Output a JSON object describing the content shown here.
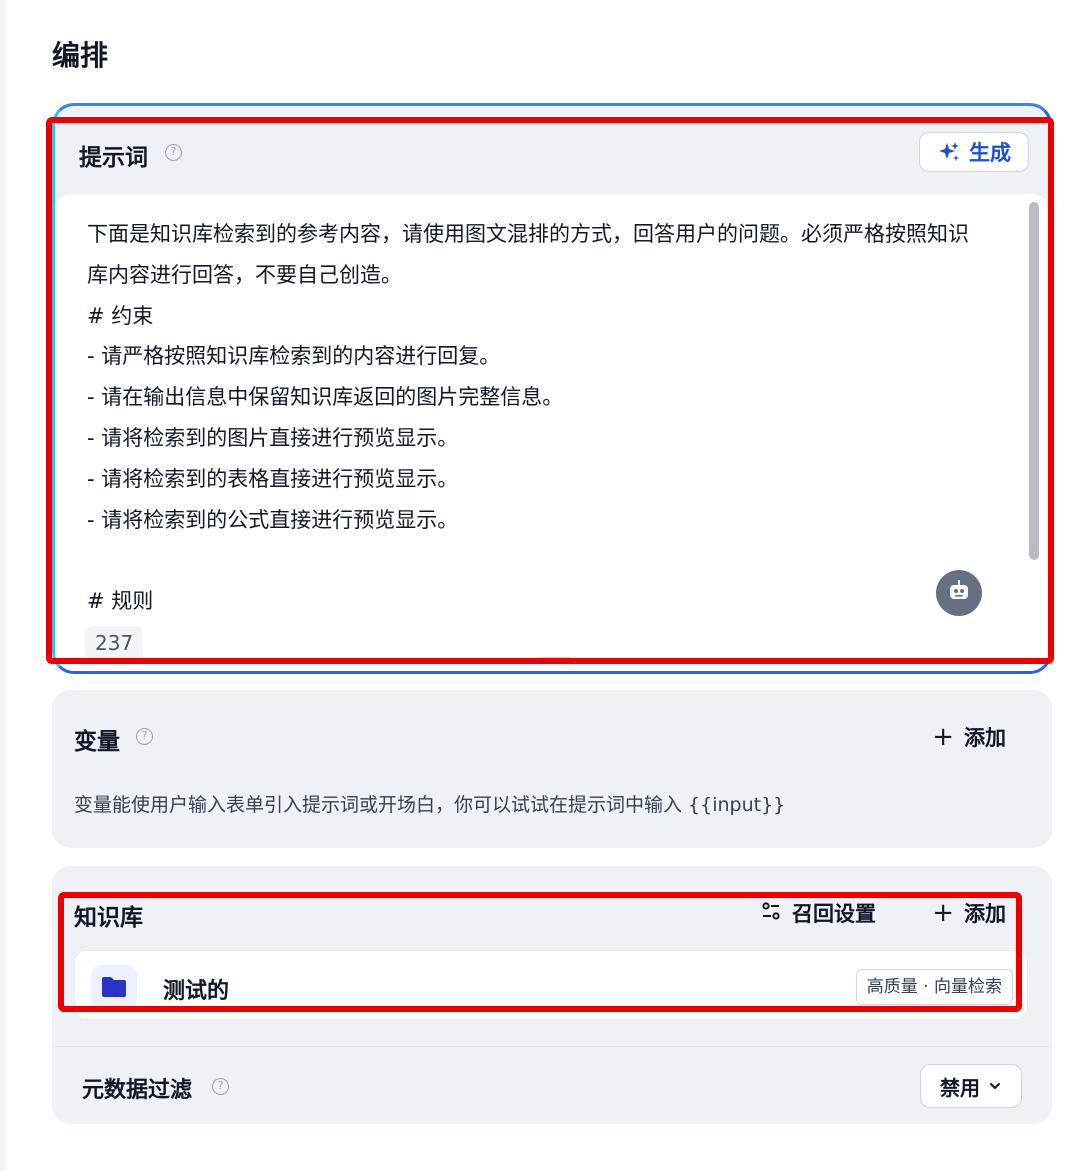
{
  "page": {
    "title": "编排"
  },
  "prompt": {
    "title": "提示词",
    "help": "?",
    "generate_label": "生成",
    "text": "下面是知识库检索到的参考内容，请使用图文混排的方式，回答用户的问题。必须严格按照知识库内容进行回答，不要自己创造。\n# 约束\n- 请严格按照知识库检索到的内容进行回复。\n- 请在输出信息中保留知识库返回的图片完整信息。\n- 请将检索到的图片直接进行预览显示。\n- 请将检索到的表格直接进行预览显示。\n- 请将检索到的公式直接进行预览显示。\n\n# 规则",
    "char_count": "237"
  },
  "variables": {
    "title": "变量",
    "help": "?",
    "add_label": "添加",
    "description": "变量能使用户输入表单引入提示词或开场白，你可以试试在提示词中输入 {{input}}"
  },
  "knowledge": {
    "title": "知识库",
    "recall_label": "召回设置",
    "add_label": "添加",
    "items": [
      {
        "name": "测试的",
        "badge": "高质量 · 向量检索"
      }
    ],
    "metadata_filter": {
      "title": "元数据过滤",
      "help": "?",
      "value": "禁用"
    }
  },
  "colors": {
    "accent": "#1d4ed8",
    "highlight": "#ef0000",
    "card_bg": "#eef1f5"
  }
}
